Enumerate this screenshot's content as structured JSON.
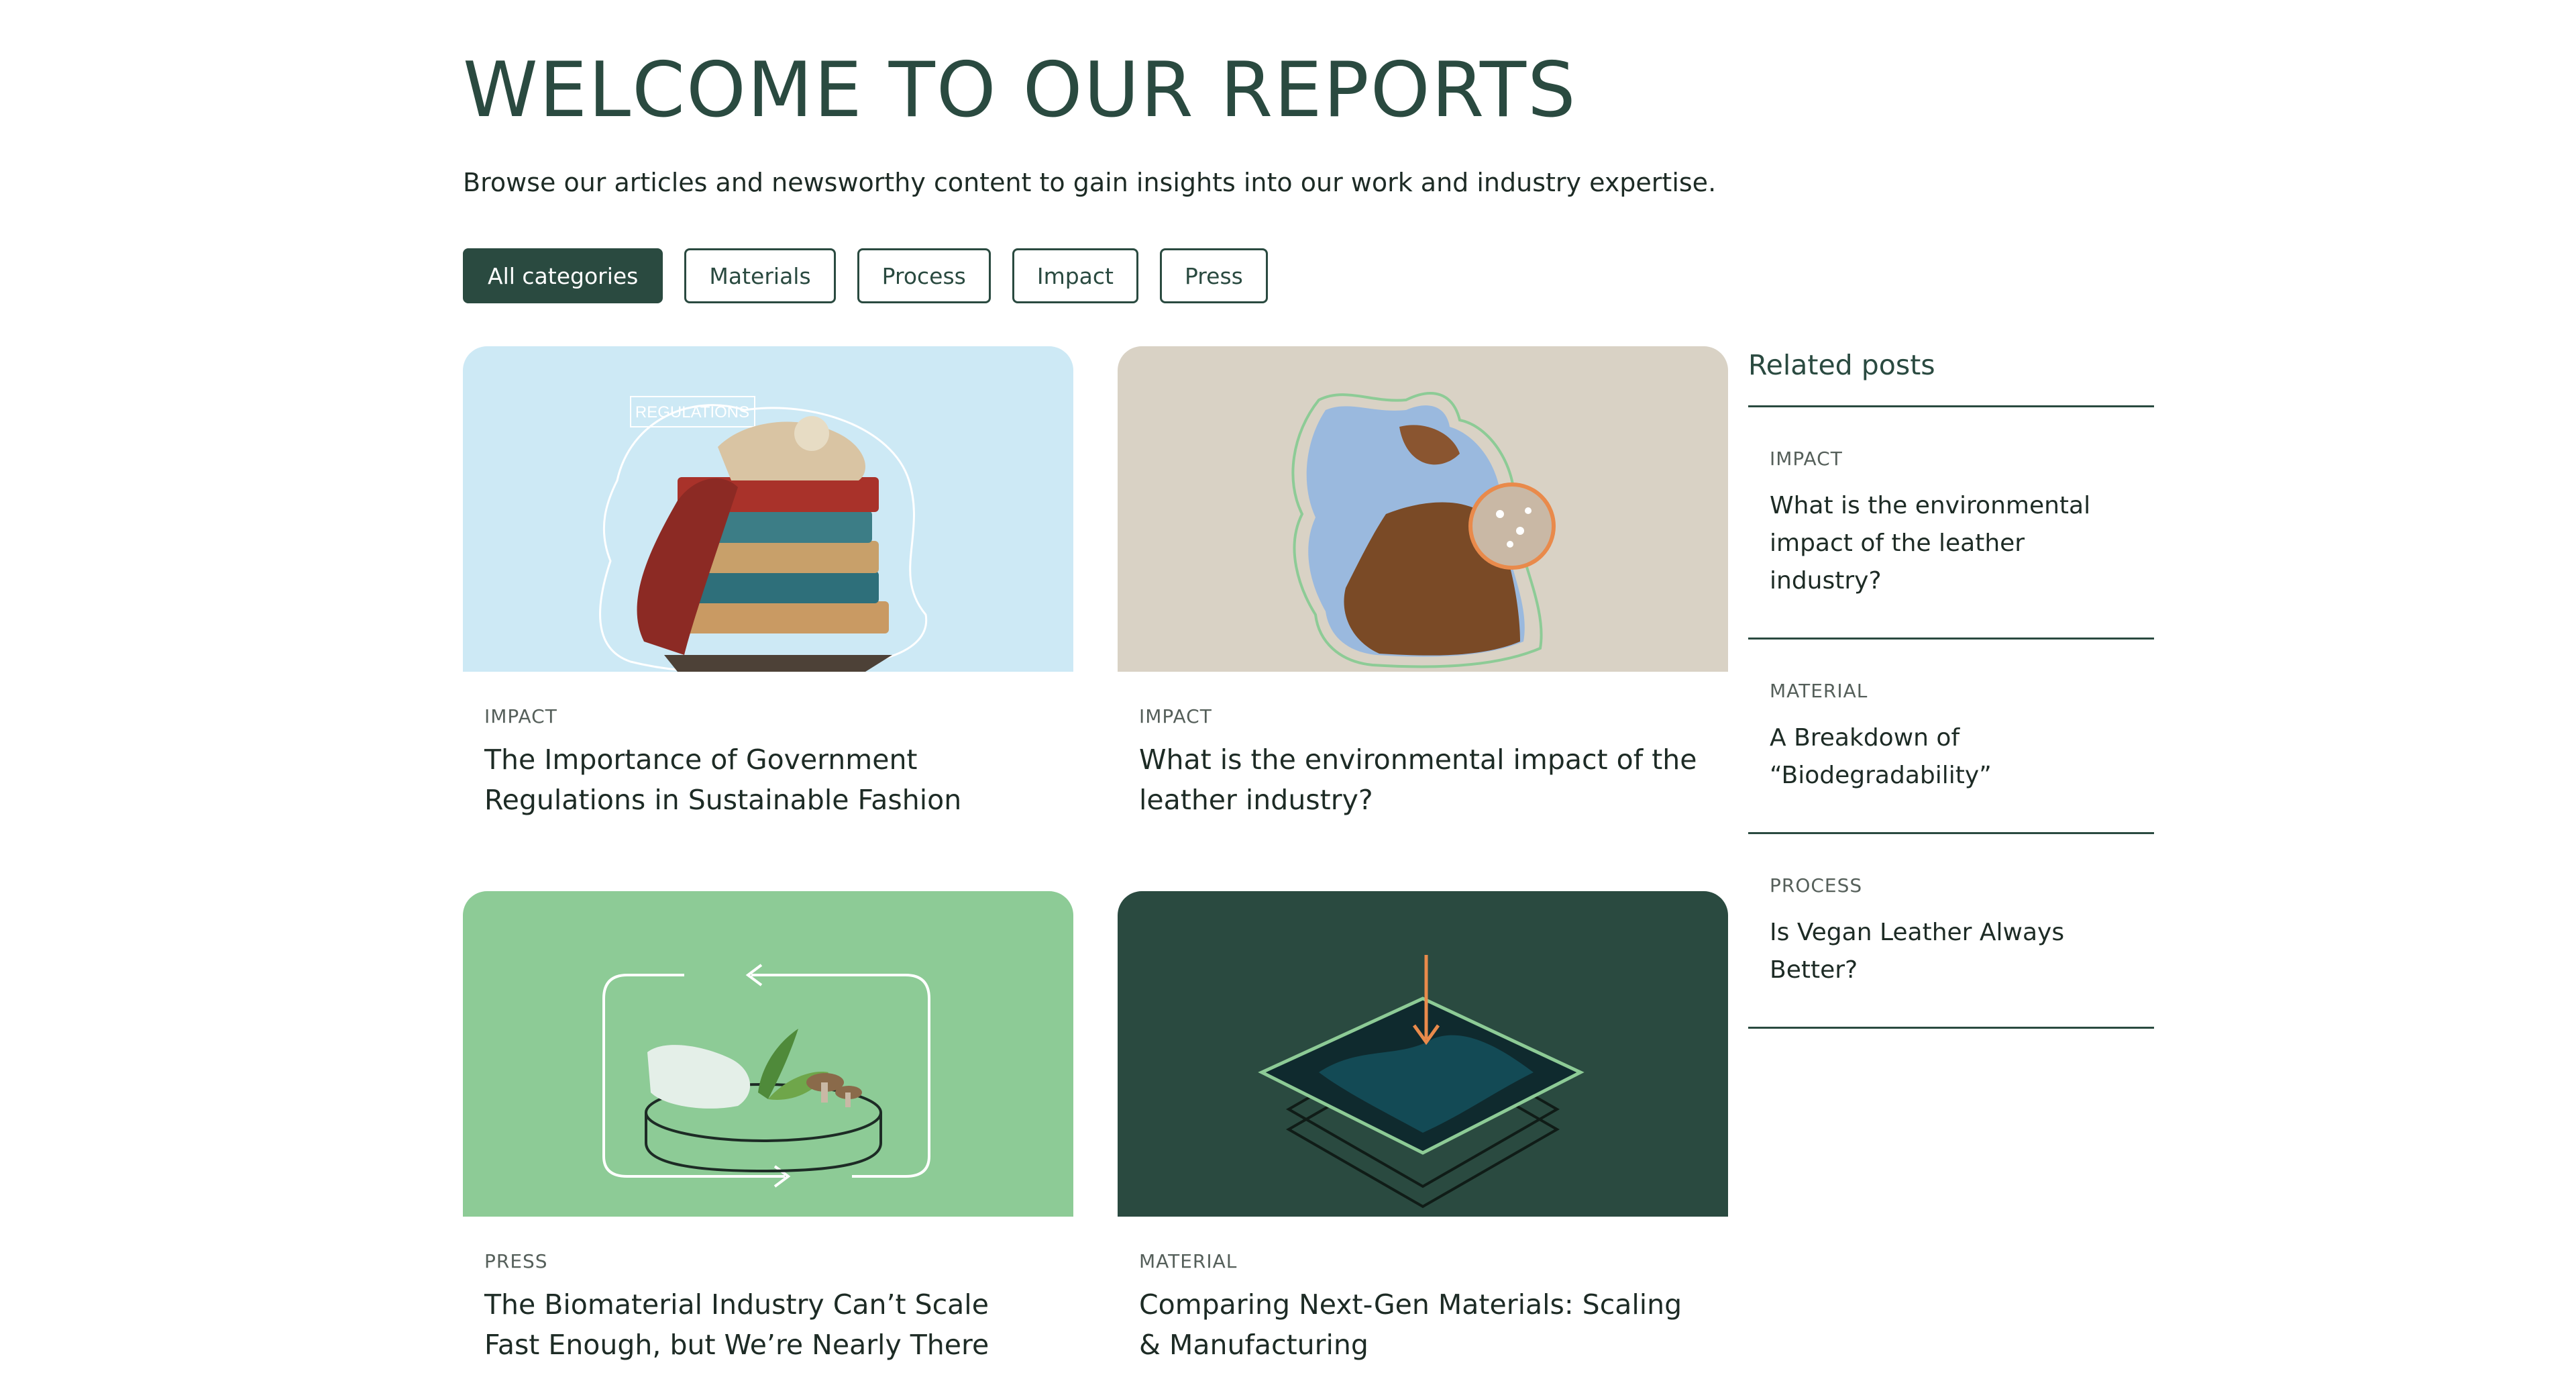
{
  "header": {
    "title": "WELCOME TO OUR REPORTS",
    "subtitle": "Browse our articles and newsworthy content to gain insights into our work and industry expertise."
  },
  "filters": [
    {
      "label": "All categories",
      "active": true
    },
    {
      "label": "Materials",
      "active": false
    },
    {
      "label": "Process",
      "active": false
    },
    {
      "label": "Impact",
      "active": false
    },
    {
      "label": "Press",
      "active": false
    }
  ],
  "cards": [
    {
      "category": "IMPACT",
      "title": "The Importance of Government Regulations in Sustainable Fashion",
      "image_label": "REGULATIONS",
      "image_bg": "#cde9f5"
    },
    {
      "category": "IMPACT",
      "title": "What is the environmental impact of the leather industry?",
      "image_bg": "#d9d2c5"
    },
    {
      "category": "PRESS",
      "title": "The Biomaterial Industry Can’t Scale Fast Enough, but We’re Nearly There",
      "image_bg": "#8dcb96"
    },
    {
      "category": "MATERIAL",
      "title": "Comparing Next-Gen Materials: Scaling & Manufacturing",
      "image_bg": "#2a4a40"
    }
  ],
  "related": {
    "heading": "Related posts",
    "items": [
      {
        "category": "IMPACT",
        "title": "What is the environmental impact of the leather industry?"
      },
      {
        "category": "MATERIAL",
        "title": "A Breakdown of “Biodegradability”"
      },
      {
        "category": "PROCESS",
        "title": "Is Vegan Leather Always Better?"
      }
    ]
  },
  "colors": {
    "brand": "#2a4a40",
    "accent_orange": "#e98a4b",
    "light_green": "#8dcb96"
  }
}
